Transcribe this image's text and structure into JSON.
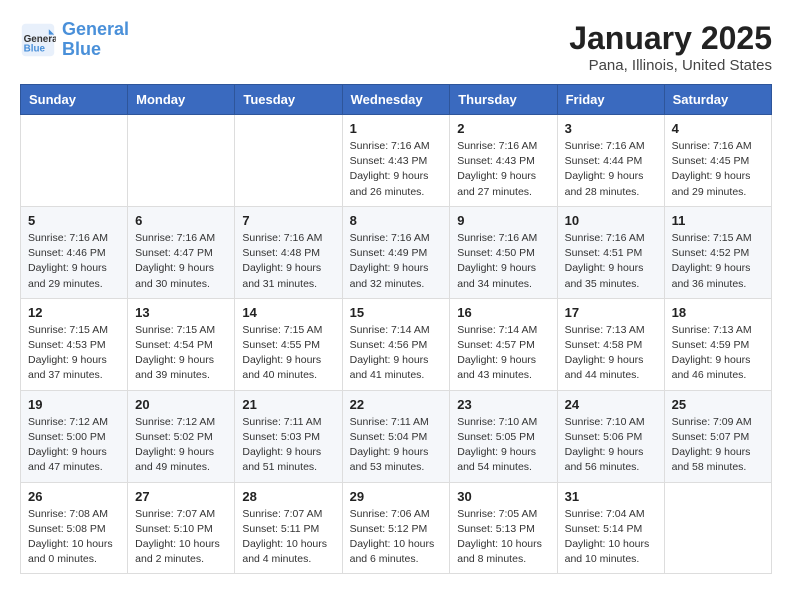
{
  "logo": {
    "text_general": "General",
    "text_blue": "Blue"
  },
  "title": "January 2025",
  "subtitle": "Pana, Illinois, United States",
  "days_of_week": [
    "Sunday",
    "Monday",
    "Tuesday",
    "Wednesday",
    "Thursday",
    "Friday",
    "Saturday"
  ],
  "weeks": [
    [
      {
        "day": "",
        "info": ""
      },
      {
        "day": "",
        "info": ""
      },
      {
        "day": "",
        "info": ""
      },
      {
        "day": "1",
        "info": "Sunrise: 7:16 AM\nSunset: 4:43 PM\nDaylight: 9 hours\nand 26 minutes."
      },
      {
        "day": "2",
        "info": "Sunrise: 7:16 AM\nSunset: 4:43 PM\nDaylight: 9 hours\nand 27 minutes."
      },
      {
        "day": "3",
        "info": "Sunrise: 7:16 AM\nSunset: 4:44 PM\nDaylight: 9 hours\nand 28 minutes."
      },
      {
        "day": "4",
        "info": "Sunrise: 7:16 AM\nSunset: 4:45 PM\nDaylight: 9 hours\nand 29 minutes."
      }
    ],
    [
      {
        "day": "5",
        "info": "Sunrise: 7:16 AM\nSunset: 4:46 PM\nDaylight: 9 hours\nand 29 minutes."
      },
      {
        "day": "6",
        "info": "Sunrise: 7:16 AM\nSunset: 4:47 PM\nDaylight: 9 hours\nand 30 minutes."
      },
      {
        "day": "7",
        "info": "Sunrise: 7:16 AM\nSunset: 4:48 PM\nDaylight: 9 hours\nand 31 minutes."
      },
      {
        "day": "8",
        "info": "Sunrise: 7:16 AM\nSunset: 4:49 PM\nDaylight: 9 hours\nand 32 minutes."
      },
      {
        "day": "9",
        "info": "Sunrise: 7:16 AM\nSunset: 4:50 PM\nDaylight: 9 hours\nand 34 minutes."
      },
      {
        "day": "10",
        "info": "Sunrise: 7:16 AM\nSunset: 4:51 PM\nDaylight: 9 hours\nand 35 minutes."
      },
      {
        "day": "11",
        "info": "Sunrise: 7:15 AM\nSunset: 4:52 PM\nDaylight: 9 hours\nand 36 minutes."
      }
    ],
    [
      {
        "day": "12",
        "info": "Sunrise: 7:15 AM\nSunset: 4:53 PM\nDaylight: 9 hours\nand 37 minutes."
      },
      {
        "day": "13",
        "info": "Sunrise: 7:15 AM\nSunset: 4:54 PM\nDaylight: 9 hours\nand 39 minutes."
      },
      {
        "day": "14",
        "info": "Sunrise: 7:15 AM\nSunset: 4:55 PM\nDaylight: 9 hours\nand 40 minutes."
      },
      {
        "day": "15",
        "info": "Sunrise: 7:14 AM\nSunset: 4:56 PM\nDaylight: 9 hours\nand 41 minutes."
      },
      {
        "day": "16",
        "info": "Sunrise: 7:14 AM\nSunset: 4:57 PM\nDaylight: 9 hours\nand 43 minutes."
      },
      {
        "day": "17",
        "info": "Sunrise: 7:13 AM\nSunset: 4:58 PM\nDaylight: 9 hours\nand 44 minutes."
      },
      {
        "day": "18",
        "info": "Sunrise: 7:13 AM\nSunset: 4:59 PM\nDaylight: 9 hours\nand 46 minutes."
      }
    ],
    [
      {
        "day": "19",
        "info": "Sunrise: 7:12 AM\nSunset: 5:00 PM\nDaylight: 9 hours\nand 47 minutes."
      },
      {
        "day": "20",
        "info": "Sunrise: 7:12 AM\nSunset: 5:02 PM\nDaylight: 9 hours\nand 49 minutes."
      },
      {
        "day": "21",
        "info": "Sunrise: 7:11 AM\nSunset: 5:03 PM\nDaylight: 9 hours\nand 51 minutes."
      },
      {
        "day": "22",
        "info": "Sunrise: 7:11 AM\nSunset: 5:04 PM\nDaylight: 9 hours\nand 53 minutes."
      },
      {
        "day": "23",
        "info": "Sunrise: 7:10 AM\nSunset: 5:05 PM\nDaylight: 9 hours\nand 54 minutes."
      },
      {
        "day": "24",
        "info": "Sunrise: 7:10 AM\nSunset: 5:06 PM\nDaylight: 9 hours\nand 56 minutes."
      },
      {
        "day": "25",
        "info": "Sunrise: 7:09 AM\nSunset: 5:07 PM\nDaylight: 9 hours\nand 58 minutes."
      }
    ],
    [
      {
        "day": "26",
        "info": "Sunrise: 7:08 AM\nSunset: 5:08 PM\nDaylight: 10 hours\nand 0 minutes."
      },
      {
        "day": "27",
        "info": "Sunrise: 7:07 AM\nSunset: 5:10 PM\nDaylight: 10 hours\nand 2 minutes."
      },
      {
        "day": "28",
        "info": "Sunrise: 7:07 AM\nSunset: 5:11 PM\nDaylight: 10 hours\nand 4 minutes."
      },
      {
        "day": "29",
        "info": "Sunrise: 7:06 AM\nSunset: 5:12 PM\nDaylight: 10 hours\nand 6 minutes."
      },
      {
        "day": "30",
        "info": "Sunrise: 7:05 AM\nSunset: 5:13 PM\nDaylight: 10 hours\nand 8 minutes."
      },
      {
        "day": "31",
        "info": "Sunrise: 7:04 AM\nSunset: 5:14 PM\nDaylight: 10 hours\nand 10 minutes."
      },
      {
        "day": "",
        "info": ""
      }
    ]
  ]
}
